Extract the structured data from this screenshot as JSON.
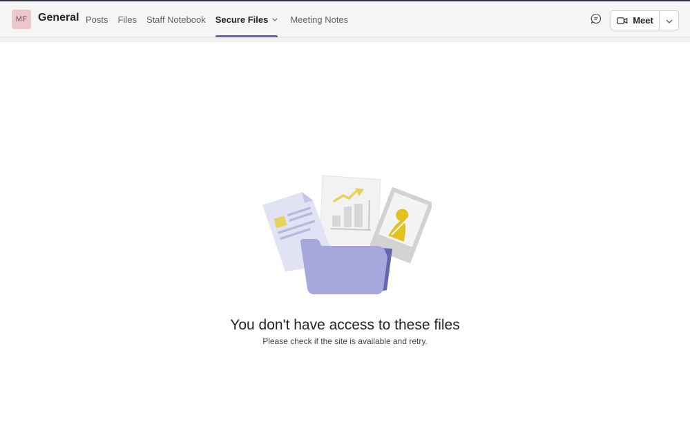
{
  "header": {
    "avatar_initials": "MF",
    "channel_title": "General",
    "tabs": [
      {
        "label": "Posts",
        "active": false
      },
      {
        "label": "Files",
        "active": false
      },
      {
        "label": "Staff Notebook",
        "active": false
      },
      {
        "label": "Secure Files",
        "active": true,
        "has_dropdown": true
      },
      {
        "label": "Meeting Notes",
        "active": false
      }
    ],
    "chat_icon": "chat-bubble-icon",
    "meet_label": "Meet",
    "meet_icon": "video-camera-icon",
    "meet_dropdown_icon": "chevron-down-icon"
  },
  "empty_state": {
    "title": "You don't have access to these files",
    "subtitle": "Please check if the site is available and retry."
  },
  "colors": {
    "accent": "#6264a7",
    "top_border": "#33344a",
    "header_bg": "#f5f5f5",
    "avatar_bg": "#e9c7cd",
    "folder": "#a6a7dc",
    "highlight_yellow": "#e8d35a"
  }
}
